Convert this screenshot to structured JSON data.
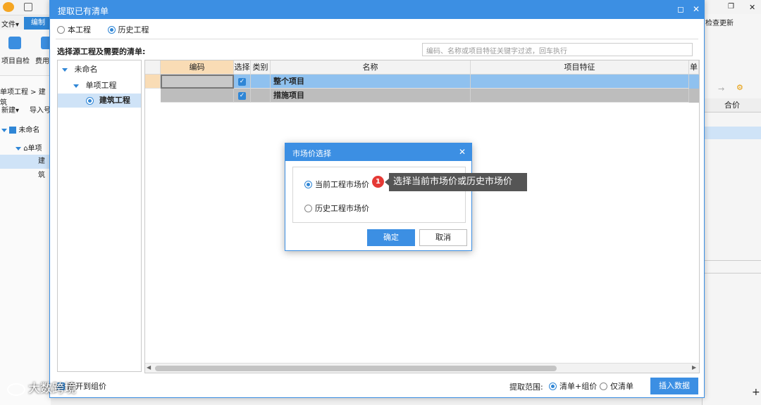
{
  "app": {
    "menu_file": "文件▾",
    "menu_edit": "编制",
    "ribbon_project_check": "项目自检",
    "ribbon_fee": "费用",
    "breadcrumb": "单项工程 > 建筑",
    "new_btn": "新建▾",
    "import_btn": "导入号",
    "tree_root": "未命名",
    "tree_single": "单项",
    "tree_build": "建筑",
    "right_update": "检查更新",
    "right_col_total": "合价"
  },
  "dialog": {
    "title": "提取已有清单",
    "radio_current": "本工程",
    "radio_history": "历史工程",
    "source_label": "选择源工程及需要的清单:",
    "search_placeholder": "编码、名称或项目特征关键字过滤，回车执行",
    "tree": {
      "root": "未命名",
      "single": "单项工程",
      "build": "建筑工程"
    },
    "columns": [
      "编码",
      "选择",
      "类别",
      "名称",
      "项目特征",
      "单"
    ],
    "rows": [
      {
        "code": "",
        "selected": "✓",
        "category": "",
        "name": "整个项目",
        "feature": ""
      },
      {
        "code": "",
        "selected": "✓",
        "category": "",
        "name": "措施项目",
        "feature": ""
      }
    ],
    "expand_label": "展开到组价",
    "range_label": "提取范围:",
    "range_opt1": "清单+组价",
    "range_opt2": "仅清单",
    "insert_btn": "插入数据"
  },
  "modal": {
    "title": "市场价选择",
    "opt_current": "当前工程市场价",
    "opt_history": "历史工程市场价",
    "ok": "确定",
    "cancel": "取消"
  },
  "tip": {
    "badge": "1",
    "text": "选择当前市场价或历史市场价"
  },
  "watermark": "大数跨境"
}
